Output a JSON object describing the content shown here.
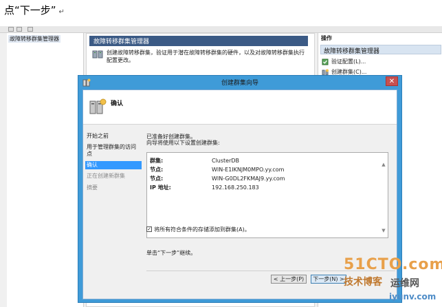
{
  "doc": {
    "title": "点“下一步”",
    "pilcrow": "↵"
  },
  "tree": {
    "item": "故障转移群集管理器"
  },
  "center": {
    "header": "故障转移群集管理器",
    "description": "创建故障转移群集，验证用于潜在故障转移群集的硬件，以及对故障转移群集执行配置更改。"
  },
  "actions": {
    "title": "操作",
    "subtitle": "故障转移群集管理器",
    "items": [
      {
        "label": "验证配置(L)...",
        "icon": "validate-icon"
      },
      {
        "label": "创建群集(C)...",
        "icon": "create-cluster-icon"
      }
    ]
  },
  "dialog": {
    "title": "创建群集向导",
    "close": "✕",
    "header_title": "确认",
    "steps": [
      {
        "label": "开始之前",
        "state": "normal"
      },
      {
        "label": "用于管理群集的访问点",
        "state": "normal"
      },
      {
        "label": "确认",
        "state": "active"
      },
      {
        "label": "正在创建新群集",
        "state": "disabled"
      },
      {
        "label": "摘要",
        "state": "disabled"
      }
    ],
    "ready_line": "已准备好创建群集。",
    "intro_line": "向导将使用以下设置创建群集:",
    "summary": [
      {
        "key": "群集:",
        "value": "ClusterDB"
      },
      {
        "key": "节点:",
        "value": "WIN-E1IKNJM0MPO.yy.com"
      },
      {
        "key": "节点:",
        "value": "WIN-G0DL2FKMAJ9.yy.com"
      },
      {
        "key": "IP 地址:",
        "value": "192.168.250.183"
      }
    ],
    "checkbox_label": "将所有符合条件的存储添加到群集(A)。",
    "checkbox_checked": true,
    "continue_text": "单击“下一步”继续。",
    "buttons": {
      "prev": "< 上一步(P)",
      "next": "下一步(N) >"
    }
  },
  "watermark": {
    "line1": "51CTO.com",
    "line2": "技术博客",
    "line3": "运维网",
    "line4": "iyunv.com"
  }
}
